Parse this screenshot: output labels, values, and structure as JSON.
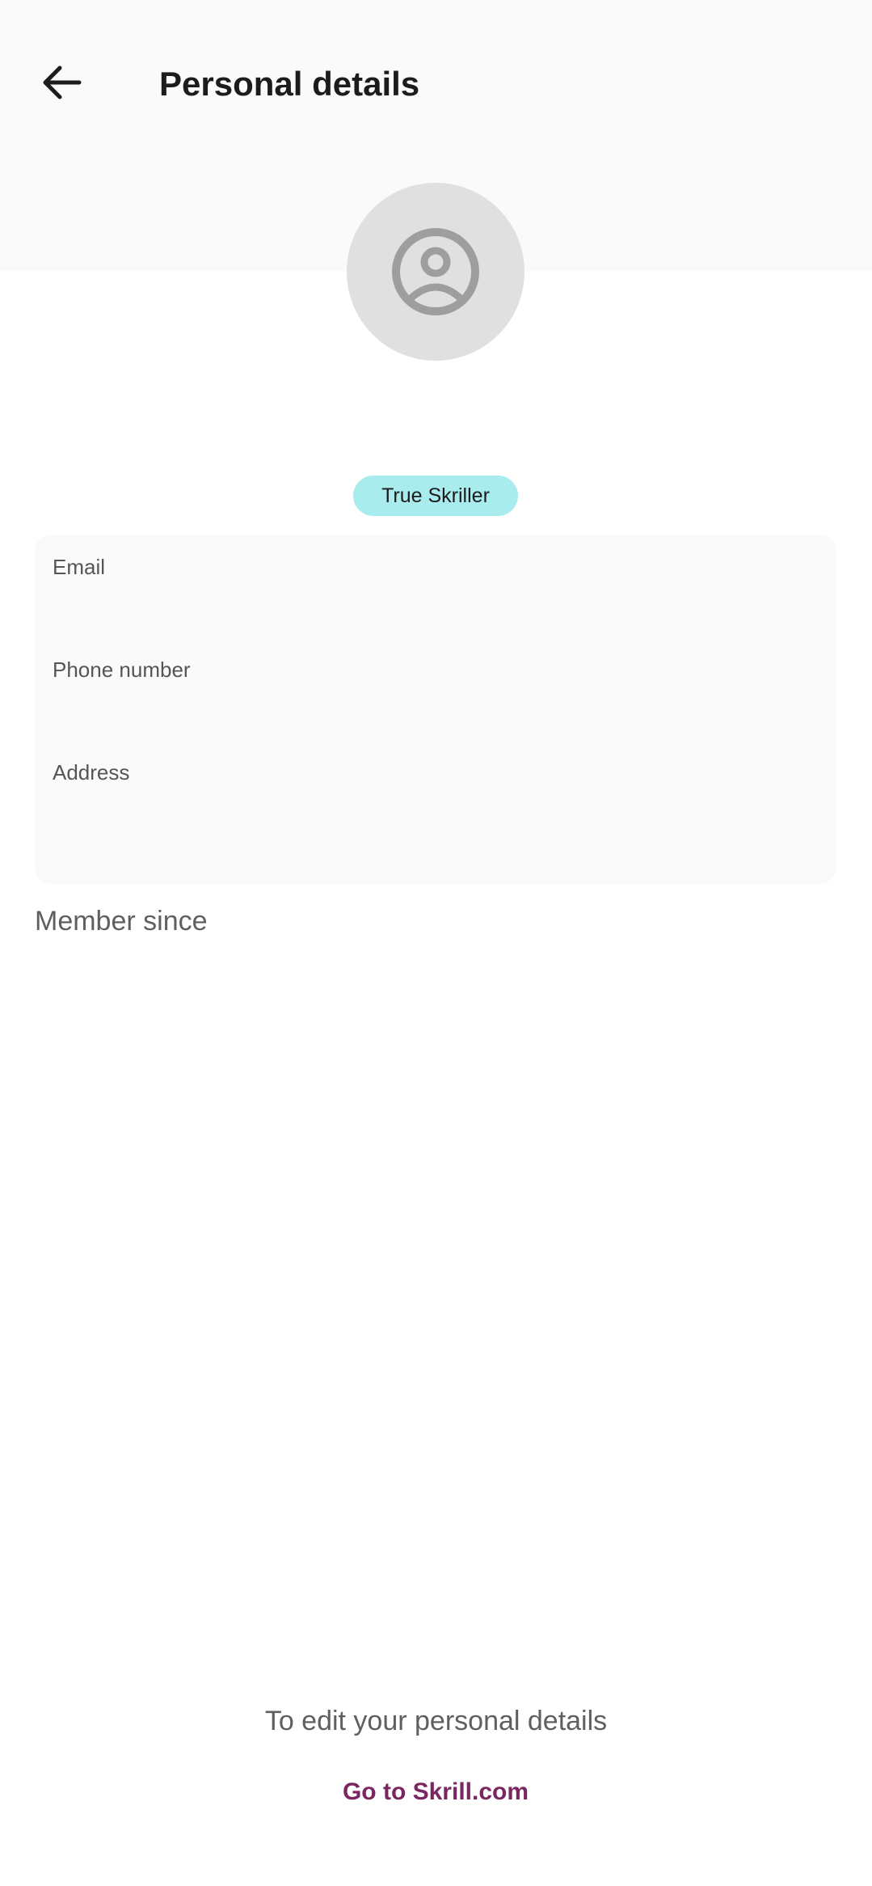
{
  "header": {
    "title": "Personal details",
    "back_icon": "arrow-left-icon"
  },
  "profile": {
    "avatar_icon": "user-circle-icon",
    "badge": "True Skriller"
  },
  "details": {
    "email_label": "Email",
    "phone_label": "Phone number",
    "address_label": "Address"
  },
  "member_since_label": "Member since",
  "footer": {
    "edit_hint": "To edit your personal details",
    "link_label": "Go to Skrill.com"
  },
  "colors": {
    "badge_bg": "#a8ecee",
    "link": "#7a2660",
    "header_bg": "#fafafa"
  }
}
